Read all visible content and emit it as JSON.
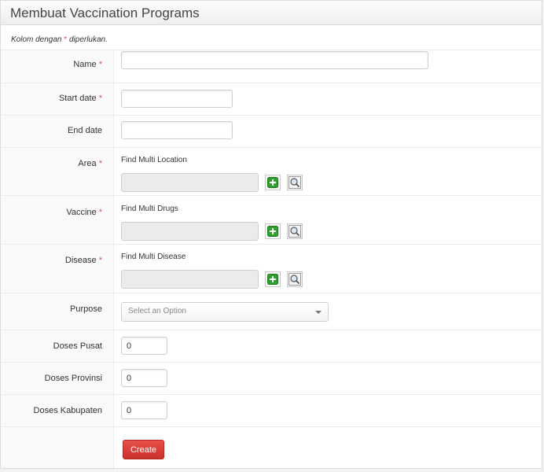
{
  "header": {
    "title": "Membuat Vaccination Programs"
  },
  "required_note": {
    "prefix": "Kolom dengan",
    "star": "*",
    "suffix": "diperlukan."
  },
  "fields": {
    "name": {
      "label": "Name",
      "star": "*",
      "value": ""
    },
    "start_date": {
      "label": "Start date",
      "star": "*",
      "value": ""
    },
    "end_date": {
      "label": "End date",
      "value": ""
    },
    "area": {
      "label": "Area",
      "star": "*",
      "finder_title": "Find Multi Location"
    },
    "vaccine": {
      "label": "Vaccine",
      "star": "*",
      "finder_title": "Find Multi Drugs"
    },
    "disease": {
      "label": "Disease",
      "star": "*",
      "finder_title": "Find Multi Disease"
    },
    "purpose": {
      "label": "Purpose",
      "placeholder": "Select an Option"
    },
    "doses_pusat": {
      "label": "Doses Pusat",
      "value": "0"
    },
    "doses_provinsi": {
      "label": "Doses Provinsi",
      "value": "0"
    },
    "doses_kabupaten": {
      "label": "Doses Kabupaten",
      "value": "0"
    }
  },
  "actions": {
    "create_label": "Create"
  },
  "icons": {
    "add": "plus-square-icon",
    "search": "magnifier-icon"
  },
  "colors": {
    "required": "#d9534f",
    "create_button": "#d9534f",
    "add_icon": "#2ea02e"
  }
}
